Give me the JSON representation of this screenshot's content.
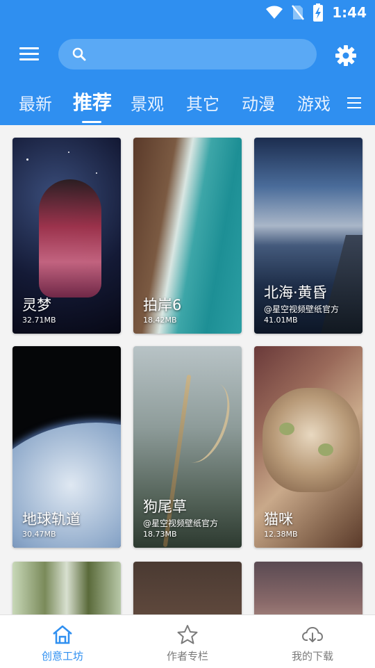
{
  "status": {
    "time": "1:44"
  },
  "header": {
    "search": {
      "placeholder": ""
    },
    "tabs": [
      "最新",
      "推荐",
      "景观",
      "其它",
      "动漫",
      "游戏"
    ],
    "active_tab": 1
  },
  "cards": [
    {
      "title": "灵梦",
      "author": "",
      "size": "32.71MB",
      "theme": "anime"
    },
    {
      "title": "拍岸6",
      "author": "",
      "size": "18.42MB",
      "theme": "coast"
    },
    {
      "title": "北海·黄昏",
      "author": "@星空视频壁纸官方",
      "size": "41.01MB",
      "theme": "dusk"
    },
    {
      "title": "地球轨道",
      "author": "",
      "size": "30.47MB",
      "theme": "earth"
    },
    {
      "title": "狗尾草",
      "author": "@星空视频壁纸官方",
      "size": "18.73MB",
      "theme": "grass"
    },
    {
      "title": "猫咪",
      "author": "",
      "size": "12.38MB",
      "theme": "cat"
    },
    {
      "title": "",
      "author": "",
      "size": "",
      "theme": "forest"
    },
    {
      "title": "",
      "author": "",
      "size": "",
      "theme": "brown"
    },
    {
      "title": "",
      "author": "",
      "size": "",
      "theme": "anime2"
    }
  ],
  "bottom_nav": [
    {
      "label": "创意工坊",
      "icon": "home-icon",
      "active": true
    },
    {
      "label": "作者专栏",
      "icon": "star-icon",
      "active": false
    },
    {
      "label": "我的下载",
      "icon": "cloud-download-icon",
      "active": false
    }
  ],
  "colors": {
    "primary": "#2f8ff0",
    "inactive": "#7a7a7a"
  }
}
